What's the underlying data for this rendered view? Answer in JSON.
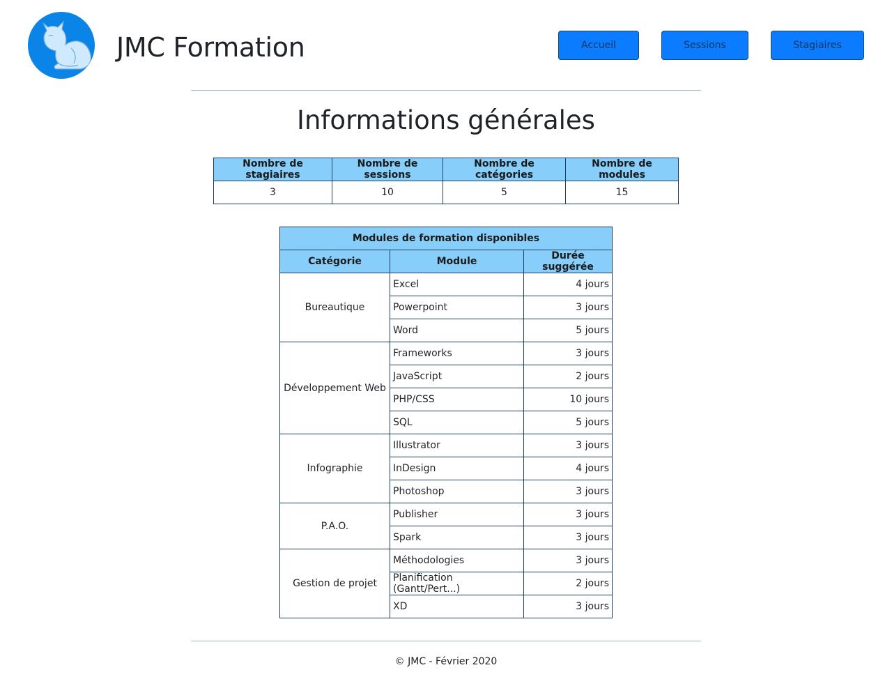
{
  "header": {
    "brand": "JMC Formation",
    "logo_icon": "cat-silhouette-icon",
    "nav": [
      "Accueil",
      "Sessions",
      "Stagiaires"
    ]
  },
  "main": {
    "title": "Informations générales",
    "stats": {
      "headers": [
        "Nombre de stagiaires",
        "Nombre de sessions",
        "Nombre de catégories",
        "Nombre de modules"
      ],
      "values": [
        "3",
        "10",
        "5",
        "15"
      ]
    },
    "modules_table": {
      "caption": "Modules de formation disponibles",
      "headers": [
        "Catégorie",
        "Module",
        "Durée suggérée"
      ],
      "categories": [
        {
          "name": "Bureautique",
          "modules": [
            {
              "name": "Excel",
              "duration": "4 jours"
            },
            {
              "name": "Powerpoint",
              "duration": "3 jours"
            },
            {
              "name": "Word",
              "duration": "5 jours"
            }
          ]
        },
        {
          "name": "Développement Web",
          "modules": [
            {
              "name": "Frameworks",
              "duration": "3 jours"
            },
            {
              "name": "JavaScript",
              "duration": "2 jours"
            },
            {
              "name": "PHP/CSS",
              "duration": "10 jours"
            },
            {
              "name": "SQL",
              "duration": "5 jours"
            }
          ]
        },
        {
          "name": "Infographie",
          "modules": [
            {
              "name": "Illustrator",
              "duration": "3 jours"
            },
            {
              "name": "InDesign",
              "duration": "4 jours"
            },
            {
              "name": "Photoshop",
              "duration": "3 jours"
            }
          ]
        },
        {
          "name": "P.A.O.",
          "modules": [
            {
              "name": "Publisher",
              "duration": "3 jours"
            },
            {
              "name": "Spark",
              "duration": "3 jours"
            }
          ]
        },
        {
          "name": "Gestion de projet",
          "modules": [
            {
              "name": "Méthodologies",
              "duration": "3 jours"
            },
            {
              "name": "Planification (Gantt/Pert...)",
              "duration": "2 jours"
            },
            {
              "name": "XD",
              "duration": "3 jours"
            }
          ]
        }
      ]
    }
  },
  "footer": {
    "text": "© JMC - Février 2020"
  },
  "colors": {
    "button": "#0b7bff",
    "table_header": "#87cefa",
    "border": "#1d3f63",
    "logo": "#0b84e8"
  }
}
